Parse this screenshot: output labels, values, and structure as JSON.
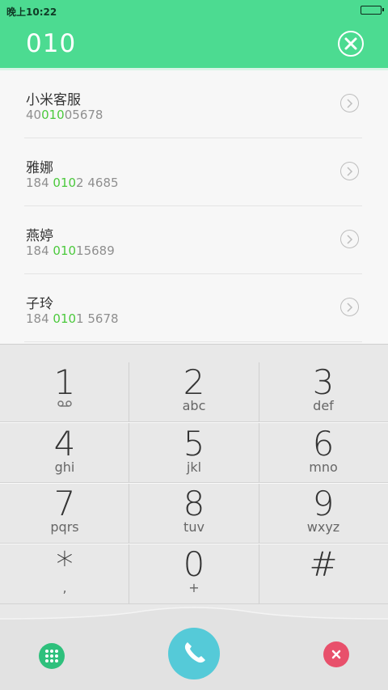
{
  "status_bar": {
    "time": "晚上10:22"
  },
  "dialer": {
    "input_value": "010"
  },
  "contacts": [
    {
      "name": "小米客服",
      "number_pre": "40",
      "number_match": "010",
      "number_post": "05678"
    },
    {
      "name": "雅娜",
      "number_pre": "184 ",
      "number_match": "010",
      "number_post": "2 4685"
    },
    {
      "name": "燕婷",
      "number_pre": "184 ",
      "number_match": "010",
      "number_post": "15689"
    },
    {
      "name": "子玲",
      "number_pre": "184 ",
      "number_match": "010",
      "number_post": "1 5678"
    }
  ],
  "keys": [
    {
      "digit": "1",
      "letters": ""
    },
    {
      "digit": "2",
      "letters": "abc"
    },
    {
      "digit": "3",
      "letters": "def"
    },
    {
      "digit": "4",
      "letters": "ghi"
    },
    {
      "digit": "5",
      "letters": "jkl"
    },
    {
      "digit": "6",
      "letters": "mno"
    },
    {
      "digit": "7",
      "letters": "pqrs"
    },
    {
      "digit": "8",
      "letters": "tuv"
    },
    {
      "digit": "9",
      "letters": "wxyz"
    },
    {
      "digit": "*",
      "letters": ","
    },
    {
      "digit": "0",
      "letters": "+"
    },
    {
      "digit": "#",
      "letters": ""
    }
  ],
  "colors": {
    "accent": "#4cdb91",
    "match": "#4cc93d",
    "call": "#55cad8",
    "delete": "#e8506b"
  }
}
